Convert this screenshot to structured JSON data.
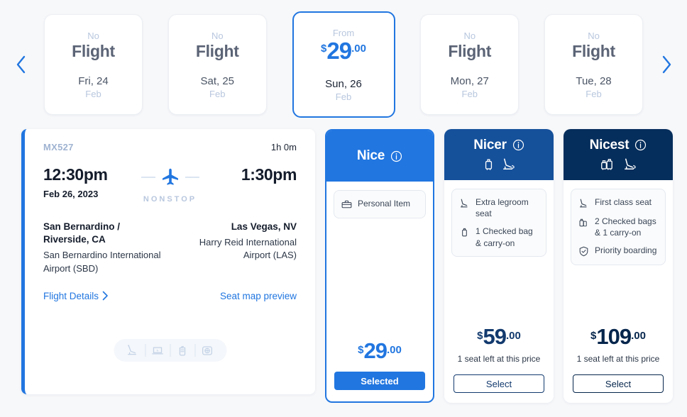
{
  "date_strip": {
    "prev_label": "chevron-left",
    "next_label": "chevron-right",
    "cards": [
      {
        "top": "No",
        "main": "Flight",
        "day": "Fri, 24",
        "month": "Feb",
        "selected": false
      },
      {
        "top": "No",
        "main": "Flight",
        "day": "Sat, 25",
        "month": "Feb",
        "selected": false
      },
      {
        "top": "From",
        "currency": "$",
        "amount": "29",
        "cents": ".00",
        "day": "Sun, 26",
        "month": "Feb",
        "selected": true
      },
      {
        "top": "No",
        "main": "Flight",
        "day": "Mon, 27",
        "month": "Feb",
        "selected": false
      },
      {
        "top": "No",
        "main": "Flight",
        "day": "Tue, 28",
        "month": "Feb",
        "selected": false
      }
    ]
  },
  "flight": {
    "flight_number": "MX527",
    "duration": "1h 0m",
    "depart_time": "12:30pm",
    "depart_date": "Feb 26, 2023",
    "arrive_time": "1:30pm",
    "stops_label": "NONSTOP",
    "origin_city": "San Bernardino / Riverside, CA",
    "origin_airport": "San Bernardino International Airport (SBD)",
    "destination_city": "Las Vegas, NV",
    "destination_airport": "Harry Reid International Airport (LAS)",
    "details_link": "Flight Details",
    "seatmap_link": "Seat map preview",
    "amenities": [
      "seat-recline-icon",
      "laptop-power-icon",
      "beverage-icon",
      "entertainment-icon"
    ]
  },
  "fares": [
    {
      "name": "Nice",
      "info_icon": "info-icon",
      "header_icons": [],
      "amenities": [
        {
          "icon": "personal-item-icon",
          "text": "Personal Item"
        }
      ],
      "currency": "$",
      "amount": "29",
      "cents": ".00",
      "seats_left": "",
      "button_label": "Selected",
      "selected": true,
      "accent": "#2176e0"
    },
    {
      "name": "Nicer",
      "info_icon": "info-icon",
      "header_icons": [
        "carry-on-bag-icon",
        "legroom-seat-icon"
      ],
      "amenities": [
        {
          "icon": "legroom-seat-icon",
          "text": "Extra legroom seat"
        },
        {
          "icon": "checked-bag-icon",
          "text": "1 Checked bag & carry-on"
        }
      ],
      "currency": "$",
      "amount": "59",
      "cents": ".00",
      "seats_left": "1 seat left at this price",
      "button_label": "Select",
      "selected": false,
      "accent": "#15509a"
    },
    {
      "name": "Nicest",
      "info_icon": "info-icon",
      "header_icons": [
        "two-bags-icon",
        "legroom-seat-icon"
      ],
      "amenities": [
        {
          "icon": "first-class-seat-icon",
          "text": "First class seat"
        },
        {
          "icon": "two-checked-bags-icon",
          "text": "2 Checked bags & 1 carry-on"
        },
        {
          "icon": "priority-shield-icon",
          "text": "Priority boarding"
        }
      ],
      "currency": "$",
      "amount": "109",
      "cents": ".00",
      "seats_left": "1 seat left at this price",
      "button_label": "Select",
      "selected": false,
      "accent": "#062e5c"
    }
  ],
  "colors": {
    "page_bg": "#f7f8fa",
    "primary_blue": "#2176e0",
    "mid_navy": "#15509a",
    "dark_navy": "#062e5c",
    "muted_text": "#b8c7de"
  }
}
